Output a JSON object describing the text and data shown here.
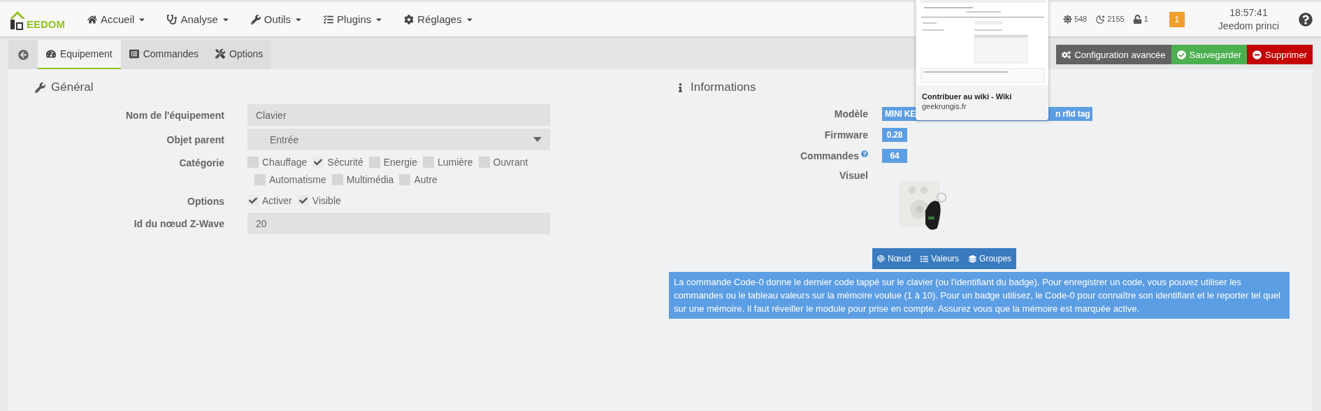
{
  "navbar": {
    "logo": "EEDOM",
    "menus": [
      {
        "label": "Accueil"
      },
      {
        "label": "Analyse"
      },
      {
        "label": "Outils"
      },
      {
        "label": "Plugins"
      },
      {
        "label": "Réglages"
      }
    ],
    "stats": [
      {
        "value": "548"
      },
      {
        "value": "2155"
      },
      {
        "value": "1"
      }
    ],
    "notification_count": "1",
    "time": "18:57:41",
    "host": "Jeedom princi"
  },
  "tabs": [
    {
      "label": "Equipement",
      "selected": true
    },
    {
      "label": "Commandes",
      "selected": false
    },
    {
      "label": "Options",
      "selected": false
    }
  ],
  "actions": [
    {
      "label": "Configuration avancée",
      "kind": "config"
    },
    {
      "label": "Sauvegarder",
      "kind": "save"
    },
    {
      "label": "Supprimer",
      "kind": "delete"
    }
  ],
  "general": {
    "title": "Général",
    "fields": [
      {
        "kind": "text",
        "label": "Nom de l'équipement",
        "value": "Clavier"
      },
      {
        "kind": "select",
        "label": "Objet parent",
        "value": "Entrée"
      },
      {
        "kind": "checkboxes",
        "label": "Catégorie",
        "options": [
          {
            "label": "Chauffage",
            "checked": false
          },
          {
            "label": "Sécurité",
            "checked": true
          },
          {
            "label": "Energie",
            "checked": false
          },
          {
            "label": "Lumière",
            "checked": false
          },
          {
            "label": "Ouvrant",
            "checked": false
          },
          {
            "label": "Automatisme",
            "checked": false
          },
          {
            "label": "Multimédia",
            "checked": false
          },
          {
            "label": "Autre",
            "checked": false
          }
        ]
      },
      {
        "kind": "checkboxes",
        "label": "Options",
        "options": [
          {
            "label": "Activer",
            "checked": true
          },
          {
            "label": "Visible",
            "checked": true
          }
        ]
      },
      {
        "kind": "text",
        "label": "Id du nœud Z-Wave",
        "value": "20"
      }
    ]
  },
  "informations": {
    "title": "Informations",
    "rows": [
      {
        "kind": "badge",
        "label": "Modèle",
        "help": false,
        "parts": [
          "MINI KE",
          "n rfid tag"
        ]
      },
      {
        "kind": "badge",
        "label": "Firmware",
        "help": false,
        "parts": [
          "0.28"
        ]
      },
      {
        "kind": "badge",
        "label": "Commandes",
        "help": true,
        "parts": [
          "64"
        ]
      },
      {
        "kind": "picture",
        "label": "Visuel",
        "help": false
      }
    ],
    "buttons": [
      {
        "label": "Nœud"
      },
      {
        "label": "Valeurs"
      },
      {
        "label": "Groupes"
      }
    ],
    "note": "La commande Code-0 donne le dernier code tappé sur le clavier (ou l'identifiant du badge). Pour enregistrer un code, vous pouvez utiliser les commandes ou le tableau valeurs sur la mémoire voulue (1 à 10). Pour un badge utilisez, le Code-0 pour connaître son identifiant et le reporter tel quel sur une mémoire. Il faut réveiller le module pour prise en compte. Assurez vous que la mémoire est marquée active."
  },
  "preview": {
    "title": "Contribuer au wiki - Wiki",
    "domain": "geekrungis.fr"
  }
}
